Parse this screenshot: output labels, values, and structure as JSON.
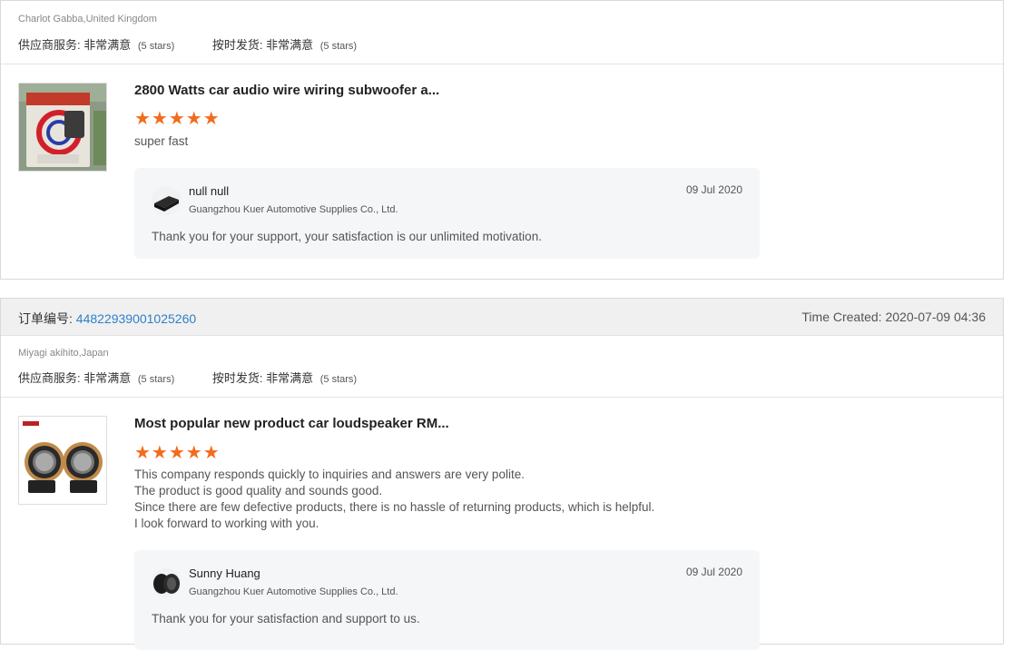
{
  "review1": {
    "buyer": "Charlot Gabba,United Kingdom",
    "supplier_service_label": "供应商服务:",
    "supplier_service_value": "非常满意",
    "supplier_service_stars": "(5 stars)",
    "ontime_label": "按时发货:",
    "ontime_value": "非常满意",
    "ontime_stars": "(5 stars)",
    "product_title": "2800 Watts car audio wire wiring subwoofer a...",
    "stars": "★★★★★",
    "feedback": "super fast",
    "reply": {
      "name": "null null",
      "company": "Guangzhou Kuer Automotive Supplies Co., Ltd.",
      "date": "09 Jul 2020",
      "text": "Thank you for your support, your satisfaction is our unlimited motivation."
    }
  },
  "review2": {
    "order_label": "订单编号:",
    "order_number": "44822939001025260",
    "time_created": "Time Created: 2020-07-09 04:36",
    "buyer": "Miyagi akihito,Japan",
    "supplier_service_label": "供应商服务:",
    "supplier_service_value": "非常满意",
    "supplier_service_stars": "(5 stars)",
    "ontime_label": "按时发货:",
    "ontime_value": "非常满意",
    "ontime_stars": "(5 stars)",
    "product_title": "Most popular new product car loudspeaker RM...",
    "stars": "★★★★★",
    "feedback_lines": [
      "This company responds quickly to inquiries and answers are very polite.",
      "The product is good quality and sounds good.",
      "Since there are few defective products, there is no hassle of returning products, which is helpful.",
      "I look forward to working with you."
    ],
    "reply": {
      "name": "Sunny Huang",
      "company": "Guangzhou Kuer Automotive Supplies Co., Ltd.",
      "date": "09 Jul 2020",
      "text": "Thank you for your satisfaction and support to us."
    }
  },
  "colors": {
    "star": "#f26c1c",
    "link": "#2f7fc9",
    "order_bar": "#f0f0f0",
    "reply_bg": "#f5f6f8"
  }
}
